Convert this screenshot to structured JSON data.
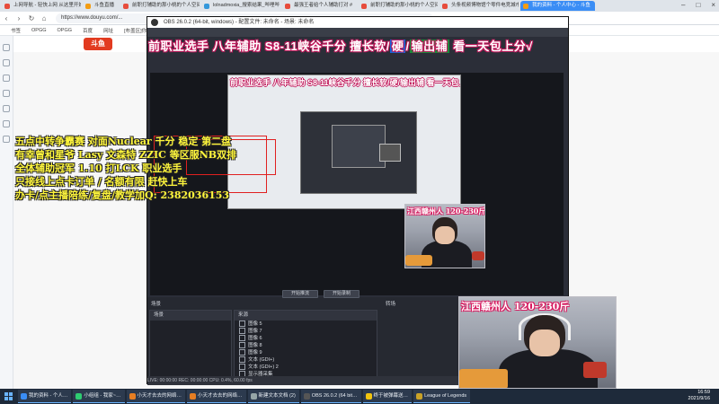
{
  "browser": {
    "tabs": [
      {
        "label": "上网导航 - 轻快上网 从这里开始",
        "icon_color": "#e74c3c",
        "active": false
      },
      {
        "label": "斗鱼直播",
        "icon_color": "#f39c12",
        "active": false
      },
      {
        "label": "前职打辅助的那小桃的个人空间_哔",
        "icon_color": "#e74c3c",
        "active": false
      },
      {
        "label": "lolnadmoxia_搜索结果_哔哩哔",
        "icon_color": "#3498db",
        "active": false
      },
      {
        "label": "最强王者给个人辅助打对 #",
        "icon_color": "#e74c3c",
        "active": false
      },
      {
        "label": "前职打辅助的那小桃的个人空间_哔",
        "icon_color": "#e74c3c",
        "active": false
      },
      {
        "label": "头条视频博物馆个零件电竞城市体",
        "icon_color": "#e74c3c",
        "active": false
      },
      {
        "label": "我的资料 - 个人中心 - 斗鱼",
        "icon_color": "#f39c12",
        "active": true
      }
    ],
    "url": "https://www.douyu.com/...",
    "bookmarks": [
      "书签",
      "OPGG",
      "OPGG",
      "百度",
      "网址",
      "[布盖区]你心嘲粉",
      "不完没意 派利百科"
    ]
  },
  "stream": {
    "logo": "斗鱼",
    "title_pre": "前职业选手 八年辅助 S8-11峡谷千分 擅长软/",
    "title_hl1": "硬",
    "title_mid": "/",
    "title_hl2": "输出辅",
    "title_post": " 看一天包上分√"
  },
  "obs": {
    "window_title": "OBS 26.0.2 (64-bit, windows) - 配置文件: 未命名 - 场景: 未命名",
    "scenes_label": "场景",
    "sources_label": "来源",
    "sources": [
      "图像 5",
      "图像 7",
      "图像 6",
      "图像 8",
      "图像 9",
      "文本 (GDI+)",
      "文本 (GDI+) 2",
      "显示器采集"
    ],
    "transition_label": "转场",
    "start_stream": "开始推流",
    "start_record": "开始录制",
    "status": "LIVE: 00:00:00  REC: 00:00:00  CPU: 0.4%, 60.00 fps",
    "preview_title": "前职业选手 八年辅助 S8-11峡谷千分 擅长软/硬/输出辅 看一天包上分√"
  },
  "announcement": [
    "五点中转争霸赛 对面Nuclear 千分 稳定 第二盘",
    "有幸曾和星爷 Lasy 文森特 ZZIC 等区服NB双排",
    "全体辅助冠军 1.10 打LCK 职业选手",
    "只接线上点卡订单 / 名额有限 赶快上车",
    "办卡/点主播陪练/复盘/教学加Q: 2382036153"
  ],
  "cam_caption_small": "江西赣州人 120-230斤",
  "cam_caption_large": "江西赣州人 120-230斤",
  "taskbar": {
    "items": [
      {
        "label": "我的资料 - 个人…",
        "icon_color": "#3a8df5"
      },
      {
        "label": "小组组 - 我家~…",
        "icon_color": "#2ecc71"
      },
      {
        "label": "小天才去去的网络…",
        "icon_color": "#e67e22"
      },
      {
        "label": "小天才去去的网络…",
        "icon_color": "#e67e22"
      },
      {
        "label": "新建文本文档 (2)",
        "icon_color": "#95a5a6"
      },
      {
        "label": "OBS 26.0.2 (64 bit…",
        "icon_color": "#555"
      },
      {
        "label": "终于被弹幕送…",
        "icon_color": "#f1c40f"
      },
      {
        "label": "League of Legends",
        "icon_color": "#c9a227"
      }
    ],
    "time": "16:59",
    "date": "2021/9/16"
  }
}
